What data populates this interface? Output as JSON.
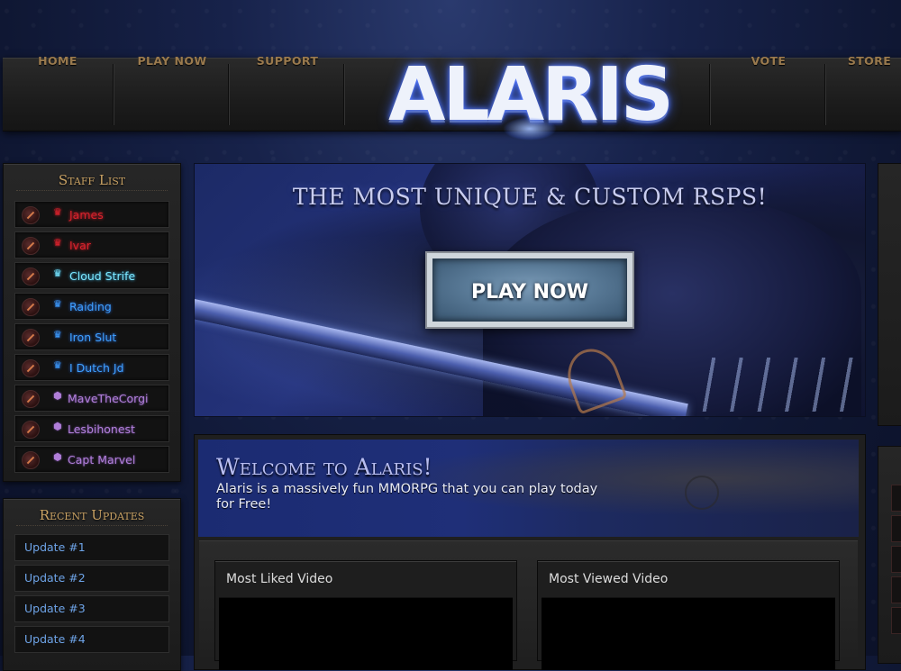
{
  "nav": {
    "items": [
      {
        "label": "HOME"
      },
      {
        "label": "PLAY NOW"
      },
      {
        "label": "SUPPORT"
      },
      {
        "label": "VOTE"
      },
      {
        "label": "STORE"
      }
    ],
    "logo_text": "ALARIS"
  },
  "staff_list": {
    "title": "Staff List",
    "members": [
      {
        "name": "James",
        "rank": "owner",
        "color": "#d8232c"
      },
      {
        "name": "Ivar",
        "rank": "owner",
        "color": "#d8232c"
      },
      {
        "name": "Cloud Strife",
        "rank": "admin",
        "color": "#7ce8ff"
      },
      {
        "name": "Raiding",
        "rank": "moderator",
        "color": "#3fa0ff"
      },
      {
        "name": "Iron Slut",
        "rank": "moderator",
        "color": "#3fa0ff"
      },
      {
        "name": "I Dutch Jd",
        "rank": "moderator",
        "color": "#3fa0ff"
      },
      {
        "name": "MaveTheCorgi",
        "rank": "support",
        "color": "#b07ed8"
      },
      {
        "name": "Lesbihonest",
        "rank": "support",
        "color": "#b07ed8"
      },
      {
        "name": "Capt Marvel",
        "rank": "support",
        "color": "#b07ed8"
      }
    ]
  },
  "recent_updates": {
    "title": "Recent Updates",
    "items": [
      {
        "label": "Update #1"
      },
      {
        "label": "Update #2"
      },
      {
        "label": "Update #3"
      },
      {
        "label": "Update #4"
      }
    ]
  },
  "banner": {
    "tagline": "THE MOST UNIQUE & CUSTOM RSPS!",
    "play_button": "PLAY NOW"
  },
  "welcome": {
    "title": "Welcome to Alaris!",
    "text": "Alaris is a massively fun MMORPG that you can play today for Free!"
  },
  "videos": {
    "most_liked": "Most Liked Video",
    "most_viewed": "Most Viewed Video"
  }
}
